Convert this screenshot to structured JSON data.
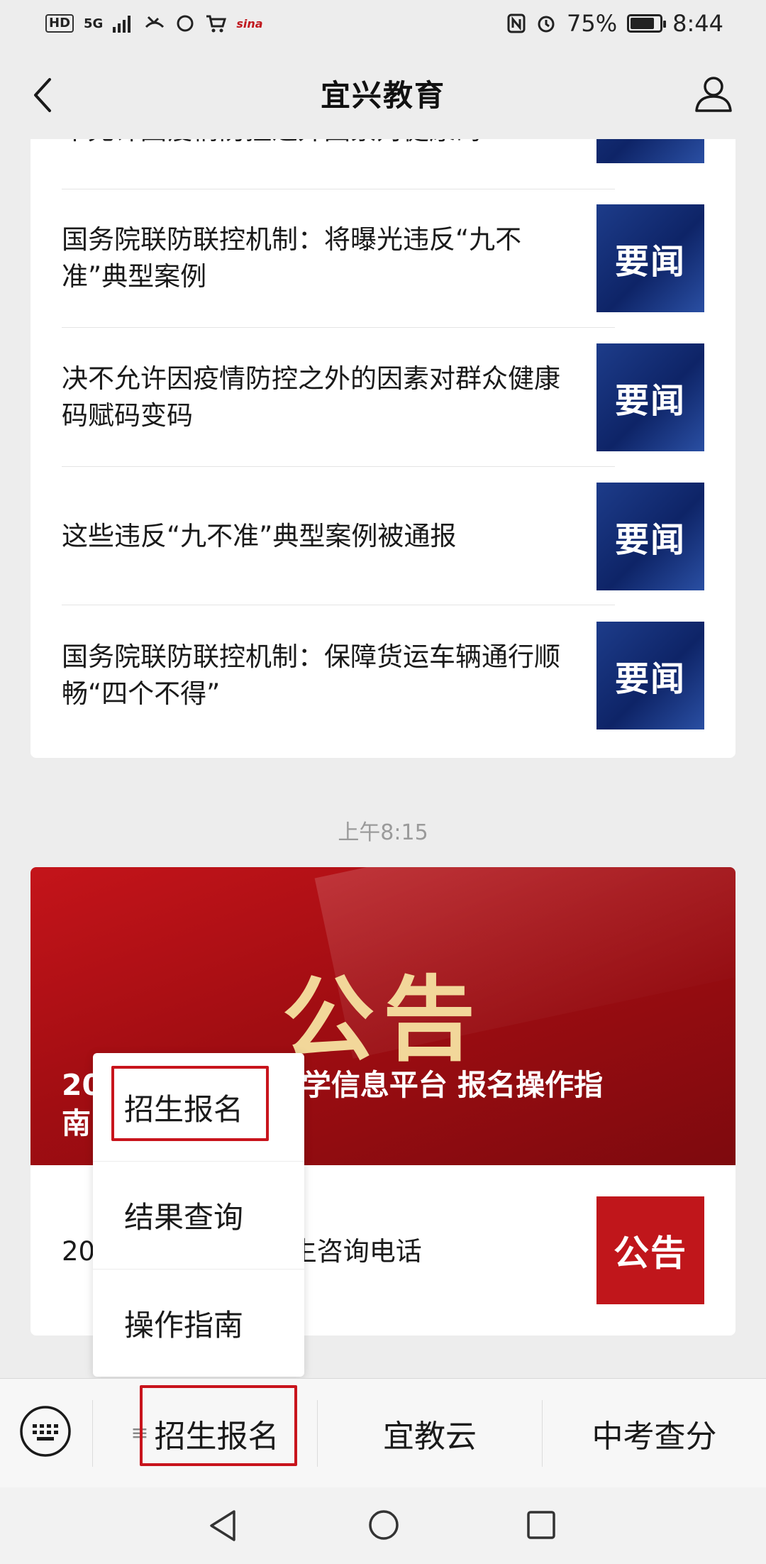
{
  "status_bar": {
    "left_badges": [
      "HD",
      "5G"
    ],
    "sina_label": "sina",
    "battery_percent": "75%",
    "battery_level": 0.75,
    "time": "8:44"
  },
  "header": {
    "title": "宜兴教育"
  },
  "articles": [
    {
      "title": "不允许因疫情防控之外因素对健康码…",
      "thumb_label": "要闻"
    },
    {
      "title": "国务院联防联控机制：将曝光违反“九不准”典型案例",
      "thumb_label": "要闻"
    },
    {
      "title": "决不允许因疫情防控之外的因素对群众健康码赋码变码",
      "thumb_label": "要闻"
    },
    {
      "title": "这些违反“九不准”典型案例被通报",
      "thumb_label": "要闻"
    },
    {
      "title": "国务院联防联控机制：保障货运车辆通行顺畅“四个不得”",
      "thumb_label": "要闻"
    }
  ],
  "timestamp": "上午8:15",
  "announcement": {
    "banner_title": "公告",
    "caption_line1": "20              生入学信息平台 报名操作指",
    "caption_line2": "南",
    "row_title": "20              初中招生咨询电话",
    "row_thumb_label": "公告"
  },
  "popup_menu": {
    "items": [
      "招生报名",
      "结果查询",
      "操作指南"
    ]
  },
  "bottom_menu": {
    "items": [
      "招生报名",
      "宜教云",
      "中考查分"
    ]
  },
  "icons": {
    "back": "chevron-left-icon",
    "user": "user-icon",
    "keyboard": "keyboard-icon",
    "menu_lines": "menu-lines-icon",
    "nav_back": "triangle-back-icon",
    "nav_home": "circle-home-icon",
    "nav_recent": "square-recent-icon"
  },
  "colors": {
    "highlight": "#c8141c",
    "news_thumb": "#142f78",
    "announcement_red": "#c0161b",
    "banner_gold": "#f2d79a"
  }
}
